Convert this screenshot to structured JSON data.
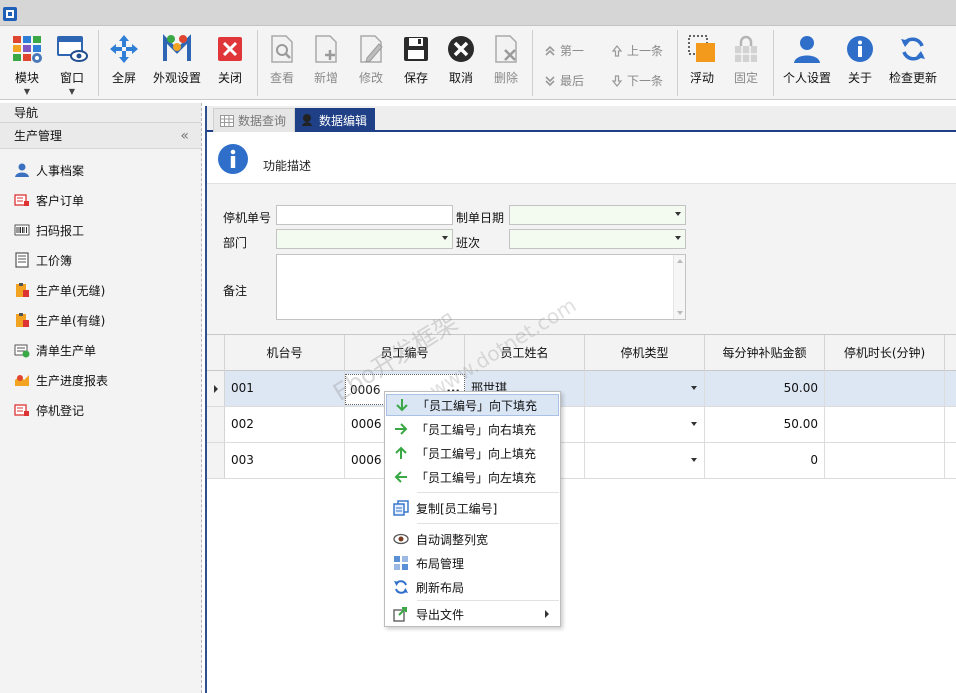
{
  "ribbon": {
    "module": "模块",
    "window": "窗口",
    "fullscreen": "全屏",
    "appearance": "外观设置",
    "close": "关闭",
    "view": "查看",
    "add": "新增",
    "edit": "修改",
    "save": "保存",
    "cancel": "取消",
    "delete": "删除",
    "first": "第一",
    "last": "最后",
    "prev": "上一条",
    "next": "下一条",
    "float": "浮动",
    "pin": "固定",
    "profile": "个人设置",
    "about": "关于",
    "update": "检查更新"
  },
  "nav": {
    "header": "导航",
    "group": "生产管理",
    "collapse": "«",
    "items": [
      {
        "label": "人事档案",
        "icon": "user-icon"
      },
      {
        "label": "客户订单",
        "icon": "order-icon"
      },
      {
        "label": "扫码报工",
        "icon": "barcode-icon"
      },
      {
        "label": "工价簿",
        "icon": "book-icon"
      },
      {
        "label": "生产单(无缝)",
        "icon": "clipboard-icon"
      },
      {
        "label": "生产单(有缝)",
        "icon": "clipboard-icon"
      },
      {
        "label": "清单生产单",
        "icon": "list-icon"
      },
      {
        "label": "生产进度报表",
        "icon": "report-icon"
      },
      {
        "label": "停机登记",
        "icon": "stop-icon"
      }
    ]
  },
  "tabs": {
    "query": "数据查询",
    "edit": "数据编辑"
  },
  "desc": {
    "text": "功能描述"
  },
  "form": {
    "stop_no_label": "停机单号",
    "stop_no_value": "",
    "date_label": "制单日期",
    "dept_label": "部门",
    "shift_label": "班次",
    "remark_label": "备注"
  },
  "grid": {
    "columns": [
      "机台号",
      "员工编号",
      "员工姓名",
      "停机类型",
      "每分钟补贴金额",
      "停机时长(分钟)"
    ],
    "rows": [
      {
        "machine": "001",
        "emp_no": "0006",
        "emp_name": "邢世琪",
        "type": "",
        "amount": "50.00",
        "duration": ""
      },
      {
        "machine": "002",
        "emp_no": "0006",
        "emp_name": "",
        "type": "",
        "amount": "50.00",
        "duration": ""
      },
      {
        "machine": "003",
        "emp_no": "0006",
        "emp_name": "",
        "type": "",
        "amount": "0",
        "duration": ""
      }
    ],
    "edit_dots": "..."
  },
  "context_menu": {
    "fill_down": "「员工编号」向下填充",
    "fill_right": "「员工编号」向右填充",
    "fill_up": "「员工编号」向上填充",
    "fill_left": "「员工编号」向左填充",
    "copy": "复制[员工编号]",
    "auto_width": "自动调整列宽",
    "layout": "布局管理",
    "refresh_layout": "刷新布局",
    "export": "导出文件"
  },
  "watermark": {
    "text1": "Ebo开发框架",
    "text2": "www.dotnet.com"
  },
  "colors": {
    "accent": "#1f3f86",
    "selected_row": "#dde7f4",
    "menu_hover": "#dbe6f5"
  }
}
